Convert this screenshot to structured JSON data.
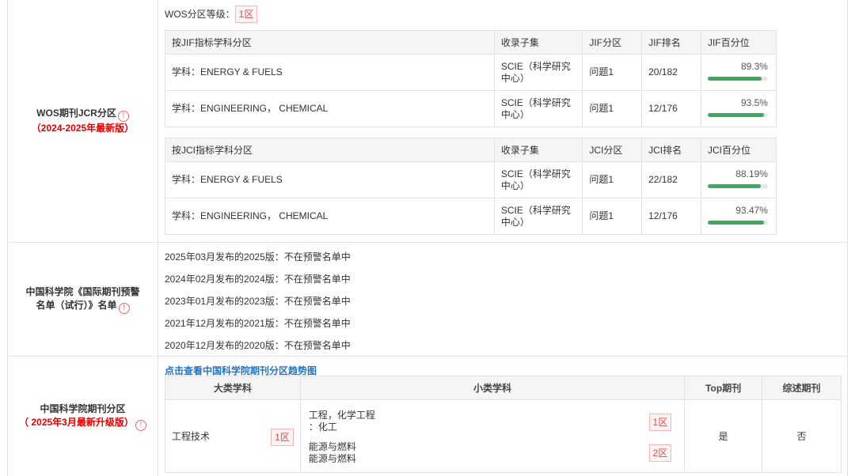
{
  "wos": {
    "label": "WOS期刊JCR分区",
    "version": "（2024-2025年最新版）",
    "level_label": "WOS分区等级：",
    "level_value": "1区",
    "jif_table": {
      "headers": [
        "按JIF指标学科分区",
        "收录子集",
        "JIF分区",
        "JIF排名",
        "JIF百分位"
      ],
      "rows": [
        {
          "subject": "学科：ENERGY & FUELS",
          "collection": "SCIE（科学研究中心）",
          "quartile": "问题1",
          "rank": "20/182",
          "percentile": "89.3%",
          "fill": 89.3
        },
        {
          "subject": "学科：ENGINEERING， CHEMICAL",
          "collection": "SCIE（科学研究中心）",
          "quartile": "问题1",
          "rank": "12/176",
          "percentile": "93.5%",
          "fill": 93.5
        }
      ]
    },
    "jci_table": {
      "headers": [
        "按JCI指标学科分区",
        "收录子集",
        "JCI分区",
        "JCI排名",
        "JCI百分位"
      ],
      "rows": [
        {
          "subject": "学科：ENERGY & FUELS",
          "collection": "SCIE（科学研究中心）",
          "quartile": "问题1",
          "rank": "22/182",
          "percentile": "88.19%",
          "fill": 88.19
        },
        {
          "subject": "学科：ENGINEERING， CHEMICAL",
          "collection": "SCIE（科学研究中心）",
          "quartile": "问题1",
          "rank": "12/176",
          "percentile": "93.47%",
          "fill": 93.47
        }
      ]
    }
  },
  "warning": {
    "label_line1": "中国科学院《国际期刊预警",
    "label_line2": "名单（试行）》名单",
    "items": [
      "2025年03月发布的2025版：不在预警名单中",
      "2024年02月发布的2024版：不在预警名单中",
      "2023年01月发布的2023版：不在预警名单中",
      "2021年12月发布的2021版：不在预警名单中",
      "2020年12月发布的2020版：不在预警名单中"
    ]
  },
  "cas": {
    "label": "中国科学院期刊分区",
    "version": "（ 2025年3月最新升级版）",
    "link": "点击查看中国科学院期刊分区趋势图",
    "headers": [
      "大类学科",
      "小类学科",
      "Top期刊",
      "综述期刊"
    ],
    "major": "工程技术",
    "major_level": "1区",
    "minor": [
      {
        "line1": "工程，化学工程",
        "line2": "：化工",
        "level": "1区"
      },
      {
        "line1": "能源与燃料",
        "line2": "能源与燃料",
        "level": "2区"
      }
    ],
    "top": "是",
    "review": "否"
  },
  "icons": {
    "info": "!"
  },
  "colors": {
    "accent_red": "#e00000",
    "link_blue": "#1e73c8",
    "bar_green": "#3fa860"
  }
}
